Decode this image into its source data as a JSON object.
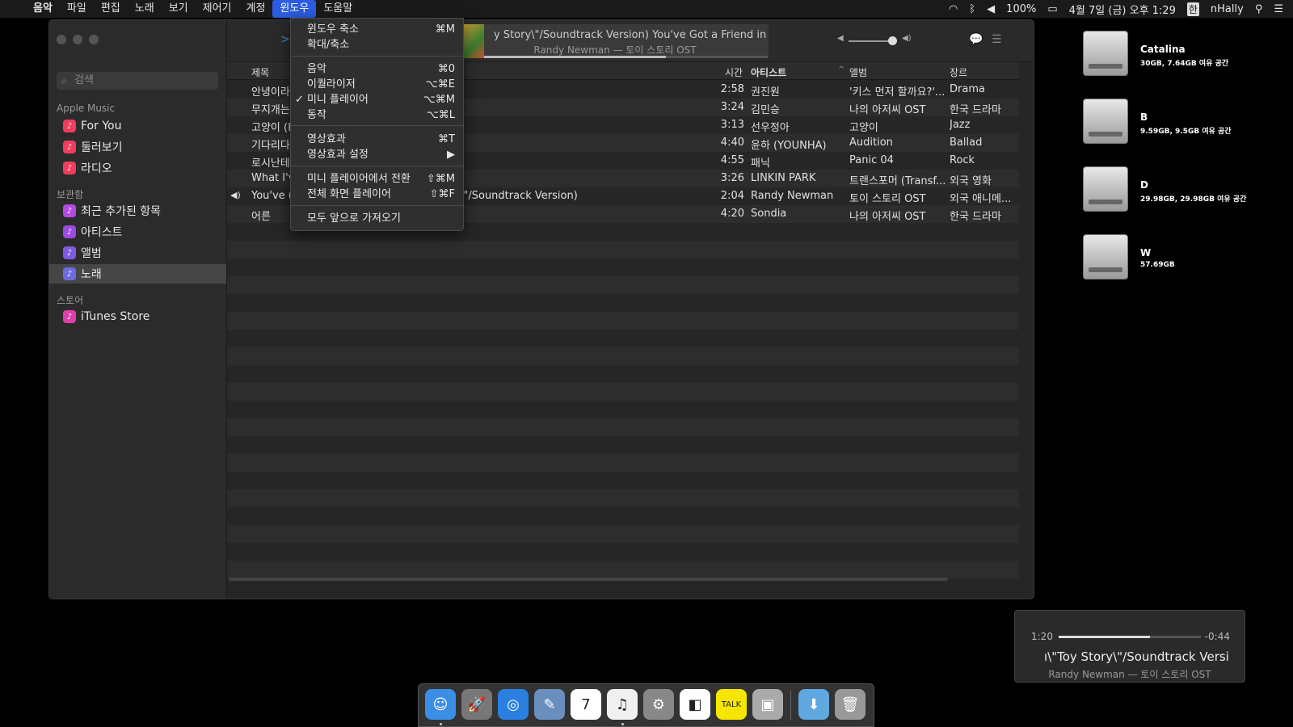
{
  "menubar": {
    "apple": "",
    "items": [
      "음악",
      "파일",
      "편집",
      "노래",
      "보기",
      "제어기",
      "계정",
      "윈도우",
      "도움말"
    ],
    "active_index": 7,
    "battery": "100%",
    "datetime": "4월 7일 (금) 오후 1:29",
    "input_source": "한",
    "user": "nHally"
  },
  "window_menu": {
    "items": [
      {
        "label": "윈도우 축소",
        "shortcut": "⌘M"
      },
      {
        "label": "확대/축소",
        "shortcut": ""
      },
      {
        "label": "음악",
        "shortcut": "⌘0"
      },
      {
        "label": "이퀄라이저",
        "shortcut": "⌥⌘E"
      },
      {
        "label": "미니 플레이어",
        "shortcut": "⌥⌘M",
        "checked": true
      },
      {
        "label": "동작",
        "shortcut": "⌥⌘L"
      },
      {
        "label": "영상효과",
        "shortcut": "⌘T"
      },
      {
        "label": "영상효과 설정",
        "shortcut": "▶"
      },
      {
        "label": "미니 플레이어에서 전환",
        "shortcut": "⇧⌘M"
      },
      {
        "label": "전체 화면 플레이어",
        "shortcut": "⇧⌘F"
      },
      {
        "label": "모두 앞으로 가져오기",
        "shortcut": ""
      }
    ],
    "check_mark": "✓"
  },
  "sidebar": {
    "search_placeholder": "검색",
    "sections": [
      {
        "title": "Apple Music",
        "items": [
          {
            "label": "For You",
            "color": "#f23b5f",
            "icon": "heart-icon"
          },
          {
            "label": "둘러보기",
            "color": "#f23b5f",
            "icon": "music-note-icon"
          },
          {
            "label": "라디오",
            "color": "#f23b5f",
            "icon": "radio-icon"
          }
        ]
      },
      {
        "title": "보관함",
        "items": [
          {
            "label": "최근 추가된 항목",
            "color": "#b24be0",
            "icon": "clock-icon"
          },
          {
            "label": "아티스트",
            "color": "#9b4be0",
            "icon": "microphone-icon"
          },
          {
            "label": "앨범",
            "color": "#7f5be0",
            "icon": "album-icon"
          },
          {
            "label": "노래",
            "color": "#6c6ce0",
            "icon": "music-note-icon",
            "selected": true
          }
        ]
      },
      {
        "title": "스토어",
        "items": [
          {
            "label": "iTunes Store",
            "color": "#e03fa8",
            "icon": "star-icon"
          }
        ]
      }
    ]
  },
  "now_playing": {
    "line1": "y Story\\\"/Soundtrack Version)   You've Got a Friend in",
    "line2": "Randy Newman — 토이 스토리 OST",
    "progress": 0.64
  },
  "volume": 0.85,
  "table": {
    "columns": [
      "제목",
      "시간",
      "아티스트",
      "앨범",
      "장르"
    ],
    "rows": [
      {
        "title": "안녕이라",
        "title_tail": ")",
        "time": "2:58",
        "artist": "권진원",
        "album": "'키스 먼저 할까요?'...",
        "genre": "Drama"
      },
      {
        "title": "무지개는",
        "title_tail": "",
        "time": "3:24",
        "artist": "김민승",
        "album": "나의 아저씨 OST",
        "genre": "한국 드라마"
      },
      {
        "title": "고양이 (F",
        "title_tail": "",
        "time": "3:13",
        "artist": "선우정아",
        "album": "고양이",
        "genre": "Jazz"
      },
      {
        "title": "기다리다",
        "title_tail": "",
        "time": "4:40",
        "artist": "윤하 (YOUNHA)",
        "album": "Audition",
        "genre": "Ballad"
      },
      {
        "title": "로시난테",
        "title_tail": "",
        "time": "4:55",
        "artist": "패닉",
        "album": "Panic 04",
        "genre": "Rock"
      },
      {
        "title": "What I'v",
        "title_tail": "",
        "time": "3:26",
        "artist": "LINKIN PARK",
        "album": "트랜스포머 (Transf...",
        "genre": "외국 영화"
      },
      {
        "title": "You've (",
        "title_tail": "\\\"/Soundtrack Version)",
        "time": "2:04",
        "artist": "Randy Newman",
        "album": "토이 스토리 OST",
        "genre": "외국 애니메...",
        "playing": true
      },
      {
        "title": "어른",
        "title_tail": "",
        "time": "4:20",
        "artist": "Sondia",
        "album": "나의 아저씨 OST",
        "genre": "한국 드라마"
      }
    ]
  },
  "drives": [
    {
      "name": "Catalina",
      "info": "30GB, 7.64GB 여유 공간"
    },
    {
      "name": "B",
      "info": "9.59GB, 9.5GB 여유 공간"
    },
    {
      "name": "D",
      "info": "29.98GB, 29.98GB 여유 공간"
    },
    {
      "name": "W",
      "info": "57.69GB"
    }
  ],
  "mini_player": {
    "elapsed": "1:20",
    "remaining": "-0:44",
    "progress": 0.64,
    "song": "\\\"Toy Story\\\"/Soundtrack Versi",
    "song_prefix": "ı",
    "artist_album": "Randy Newman — 토이 스토리 OST"
  },
  "dock": {
    "apps": [
      {
        "icon": "finder-icon",
        "color": "#3a8ee6",
        "glyph": "☺",
        "running": true
      },
      {
        "icon": "launchpad-icon",
        "color": "#777",
        "glyph": "🚀"
      },
      {
        "icon": "safari-icon",
        "color": "#2a7fe0",
        "glyph": "◎"
      },
      {
        "icon": "preview-icon",
        "color": "#6a8fbf",
        "glyph": "✎"
      },
      {
        "icon": "calendar-icon",
        "color": "#ffffff",
        "glyph": "7"
      },
      {
        "icon": "itunes-icon",
        "color": "#f0f0f0",
        "glyph": "♫",
        "running": true
      },
      {
        "icon": "system-preferences-icon",
        "color": "#888",
        "glyph": "⚙"
      },
      {
        "icon": "line-icon",
        "color": "#ffffff",
        "glyph": "◧"
      },
      {
        "icon": "kakaotalk-icon",
        "color": "#f7e600",
        "glyph": "TALK"
      },
      {
        "icon": "archive-utility-icon",
        "color": "#aaa",
        "glyph": "▣"
      },
      {
        "icon": "downloads-folder-icon",
        "color": "#5fa8e0",
        "glyph": "⬇"
      },
      {
        "icon": "trash-icon",
        "color": "#999",
        "glyph": "🗑"
      }
    ]
  }
}
